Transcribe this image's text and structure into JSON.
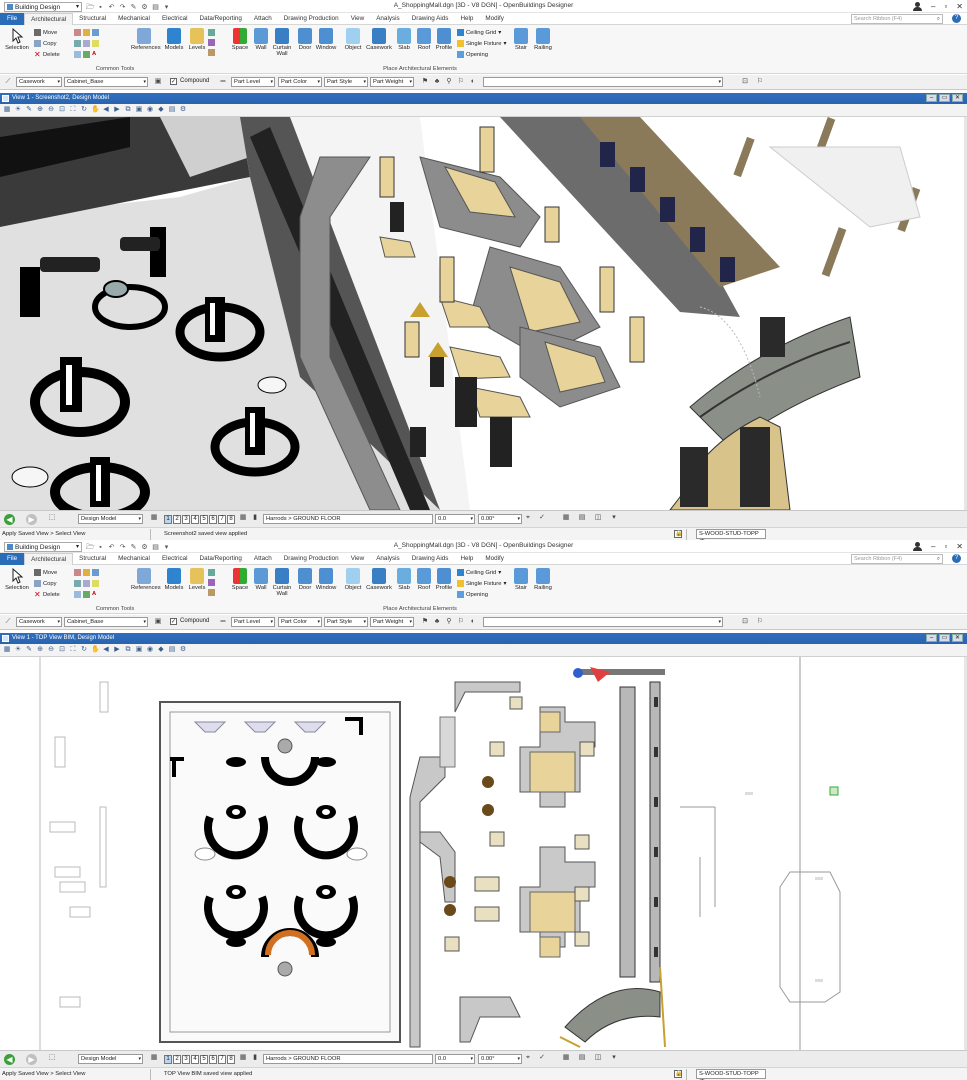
{
  "screens": [
    {
      "workspace": "Building Design",
      "window_title": "A_ShoppingMall.dgn [3D - V8 DGN] - OpenBuildings Designer",
      "tabs": [
        "File",
        "Architectural",
        "Structural",
        "Mechanical",
        "Electrical",
        "Data/Reporting",
        "Attach",
        "Drawing Production",
        "View",
        "Analysis",
        "Drawing Aids",
        "Help",
        "Modify"
      ],
      "search_placeholder": "Search Ribbon (F4)",
      "view_title": "View 1 - Screenshot2, Design Model",
      "model": "Design Model",
      "floor": "Harrods > GROUND FLOOR",
      "coord": "0.0",
      "angle": "0.00°",
      "prompt": "Apply Saved View > Select View",
      "message": "Screenshot2 saved view applied",
      "level": "S-WOOD-STUD-TOPP (T"
    },
    {
      "workspace": "Building Design",
      "window_title": "A_ShoppingMall.dgn [3D - V8 DGN] - OpenBuildings Designer",
      "tabs": [
        "File",
        "Architectural",
        "Structural",
        "Mechanical",
        "Electrical",
        "Data/Reporting",
        "Attach",
        "Drawing Production",
        "View",
        "Analysis",
        "Drawing Aids",
        "Help",
        "Modify"
      ],
      "search_placeholder": "Search Ribbon (F4)",
      "view_title": "View 1 - TOP View BIM, Design Model",
      "model": "Design Model",
      "floor": "Harrods > GROUND FLOOR",
      "coord": "0.0",
      "angle": "0.00°",
      "prompt": "Apply Saved View > Select View",
      "message": "TOP View BIM saved view applied",
      "level": "S-WOOD-STUD-TOPP (T"
    }
  ],
  "ribbon": {
    "selection": "Selection",
    "move": "Move",
    "copy": "Copy",
    "delete": "Delete",
    "common_tools": "Common Tools",
    "references": "References",
    "models": "Models",
    "levels": "Levels",
    "space": "Space",
    "wall": "Wall",
    "curtain_wall": "Curtain Wall",
    "door": "Door",
    "window": "Window",
    "object": "Object",
    "casework": "Casework",
    "slab": "Slab",
    "roof": "Roof",
    "profile": "Profile",
    "ceiling_grid": "Ceiling Grid",
    "single_fixture": "Single Fixture",
    "opening": "Opening",
    "stair": "Stair",
    "railing": "Railing",
    "place_arch": "Place Architectural Elements"
  },
  "attributes": {
    "family": "Casework",
    "part": "Cabinet_Base",
    "compound": "Compound",
    "part_level": "Part Level",
    "part_color": "Part Color",
    "part_style": "Part Style",
    "part_weight": "Part Weight"
  },
  "view_numbers": [
    "1",
    "2",
    "3",
    "4",
    "5",
    "6",
    "7",
    "8"
  ],
  "colors": {
    "file_tab": "#2b6cb8",
    "view_header": "#2f6fc1",
    "gold": "#e8d49a",
    "stone": "#8a8a8a"
  }
}
